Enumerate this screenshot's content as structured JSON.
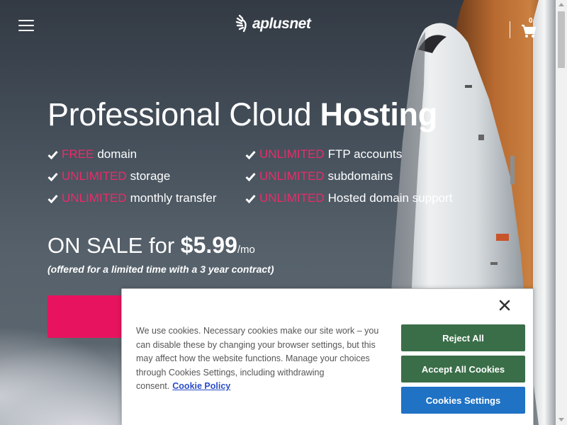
{
  "header": {
    "menu_icon": "hamburger-menu-icon",
    "logo_text": "aplusnet",
    "cart_count": "0",
    "cart_icon": "shopping-cart-icon"
  },
  "hero": {
    "headline_light": "Professional Cloud ",
    "headline_bold": "Hosting",
    "features": [
      {
        "highlight": "FREE",
        "text": "domain"
      },
      {
        "highlight": "UNLIMITED",
        "text": "storage"
      },
      {
        "highlight": "UNLIMITED",
        "text": "monthly transfer"
      },
      {
        "highlight": "UNLIMITED",
        "text": "FTP accounts"
      },
      {
        "highlight": "UNLIMITED",
        "text": "subdomains"
      },
      {
        "highlight": "UNLIMITED",
        "text": "Hosted domain support"
      }
    ],
    "sale_prefix": "ON SALE for ",
    "sale_price": "$5.99",
    "sale_period": "/mo",
    "contract_note": "(offered for a limited time with a 3 year contract)"
  },
  "colors": {
    "accent": "#ee2a68",
    "cta": "#e8135e",
    "cookie_green": "#3a6e48",
    "cookie_blue": "#1f72c4"
  },
  "cookie_banner": {
    "text": "We use cookies. Necessary cookies make our site work – you can disable these by changing your browser settings, but this may affect how the website functions. Manage your choices through Cookies Settings, including withdrawing consent.",
    "link_label": "Cookie Policy",
    "reject_label": "Reject All",
    "accept_label": "Accept All Cookies",
    "settings_label": "Cookies Settings",
    "close_icon": "close-icon"
  }
}
